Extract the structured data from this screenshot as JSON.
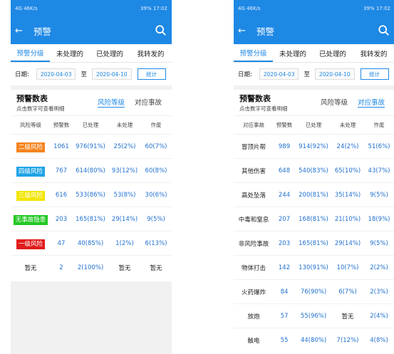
{
  "status_bar": {
    "left": "4G 46K/s",
    "right": "39%  17:02",
    "right2": "39%  17:02"
  },
  "app_bar": {
    "title": "预警"
  },
  "tabs": [
    "预警分级",
    "未处理的",
    "已处理的",
    "我转发的"
  ],
  "date_row": {
    "label": "日期:",
    "from": "2020-04-03",
    "sep": "至",
    "to": "2020-04-10",
    "button": "统计"
  },
  "section": {
    "title": "预警数表",
    "subtitle": "点击数字可查看明细",
    "toggle_risk": "风险等级",
    "toggle_event": "对应事故"
  },
  "colors": {
    "primary": "#1e88e5",
    "orange": "#f5841f",
    "blue": "#1ea3e6",
    "yellow": "#f2e600",
    "green": "#24c724",
    "red": "#e01b1b"
  },
  "left_table": {
    "headers": [
      "风险等级",
      "预警数",
      "已处理",
      "未处理",
      "作废"
    ],
    "rows": [
      {
        "level": "二级风险",
        "color": "#f5841f",
        "count": "1061",
        "done": "976(91%)",
        "todo": "25(2%)",
        "void": "60(7%)"
      },
      {
        "level": "四级风险",
        "color": "#1ea3e6",
        "count": "767",
        "done": "614(80%)",
        "todo": "93(12%)",
        "void": "60(8%)"
      },
      {
        "level": "三级风险",
        "color": "#f2e600",
        "count": "616",
        "done": "533(86%)",
        "todo": "53(8%)",
        "void": "30(6%)"
      },
      {
        "level": "无事故隐患",
        "color": "#24c724",
        "count": "203",
        "done": "165(81%)",
        "todo": "29(14%)",
        "void": "9(5%)"
      },
      {
        "level": "一级风险",
        "color": "#e01b1b",
        "count": "47",
        "done": "40(85%)",
        "todo": "1(2%)",
        "void": "6(13%)"
      },
      {
        "level": "暂无",
        "color": "",
        "count": "2",
        "done": "2(100%)",
        "todo": "暂无",
        "void": "暂无"
      }
    ]
  },
  "right_table": {
    "headers": [
      "对应事故",
      "预警数",
      "已处理",
      "未处理",
      "作废"
    ],
    "rows": [
      {
        "event": "冒顶片帮",
        "count": "989",
        "done": "914(92%)",
        "todo": "24(2%)",
        "void": "51(6%)"
      },
      {
        "event": "其他伤害",
        "count": "648",
        "done": "540(83%)",
        "todo": "65(10%)",
        "void": "43(7%)"
      },
      {
        "event": "高处坠落",
        "count": "244",
        "done": "200(81%)",
        "todo": "35(14%)",
        "void": "9(5%)"
      },
      {
        "event": "中毒和窒息",
        "count": "207",
        "done": "168(81%)",
        "todo": "21(10%)",
        "void": "18(9%)"
      },
      {
        "event": "非风险事故",
        "count": "203",
        "done": "165(81%)",
        "todo": "29(14%)",
        "void": "9(5%)"
      },
      {
        "event": "物体打击",
        "count": "142",
        "done": "130(91%)",
        "todo": "10(7%)",
        "void": "2(2%)"
      },
      {
        "event": "火药爆炸",
        "count": "84",
        "done": "76(90%)",
        "todo": "6(7%)",
        "void": "2(3%)"
      },
      {
        "event": "放炮",
        "count": "57",
        "done": "55(96%)",
        "todo": "暂无",
        "void": "2(4%)"
      },
      {
        "event": "触电",
        "count": "55",
        "done": "44(80%)",
        "todo": "7(12%)",
        "void": "4(8%)"
      }
    ]
  }
}
